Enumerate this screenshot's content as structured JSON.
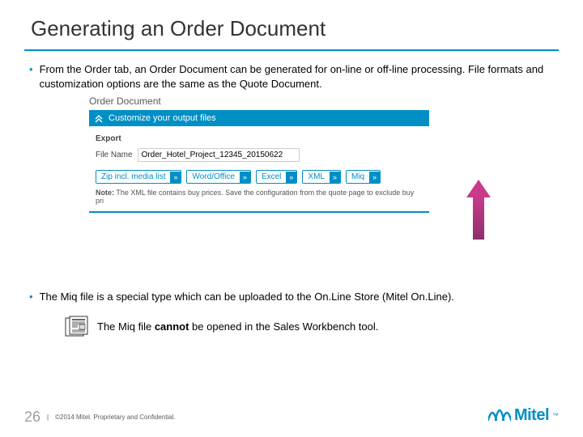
{
  "title": "Generating an Order Document",
  "bullets": {
    "b1": "From the Order tab, an Order Document can be generated for on-line or off-line processing. File formats and customization options are the same as the Quote Document.",
    "b2": "The Miq file is a special type which can be uploaded to the On.Line Store (Mitel On.Line)."
  },
  "note": {
    "prefix": "The Miq file ",
    "em": "cannot",
    "suffix": " be opened in the Sales Workbench tool."
  },
  "screenshot": {
    "panel_title": "Order Document",
    "customize_bar": "Customize your output files",
    "export_label": "Export",
    "filename_label": "File Name",
    "filename_value": "Order_Hotel_Project_12345_20150622",
    "buttons": {
      "zip": "Zip incl. media list",
      "word": "Word/Office",
      "excel": "Excel",
      "xml": "XML",
      "miq": "Miq"
    },
    "note_label": "Note:",
    "note_text": " The XML file contains buy prices. Save the configuration from the quote page to exclude buy pri",
    "chevron": "»"
  },
  "footer": {
    "page": "26",
    "sep": "|",
    "copyright": "©2014 Mitel. Proprietary and Confidential.",
    "brand": "Mitel",
    "tm": "™"
  }
}
